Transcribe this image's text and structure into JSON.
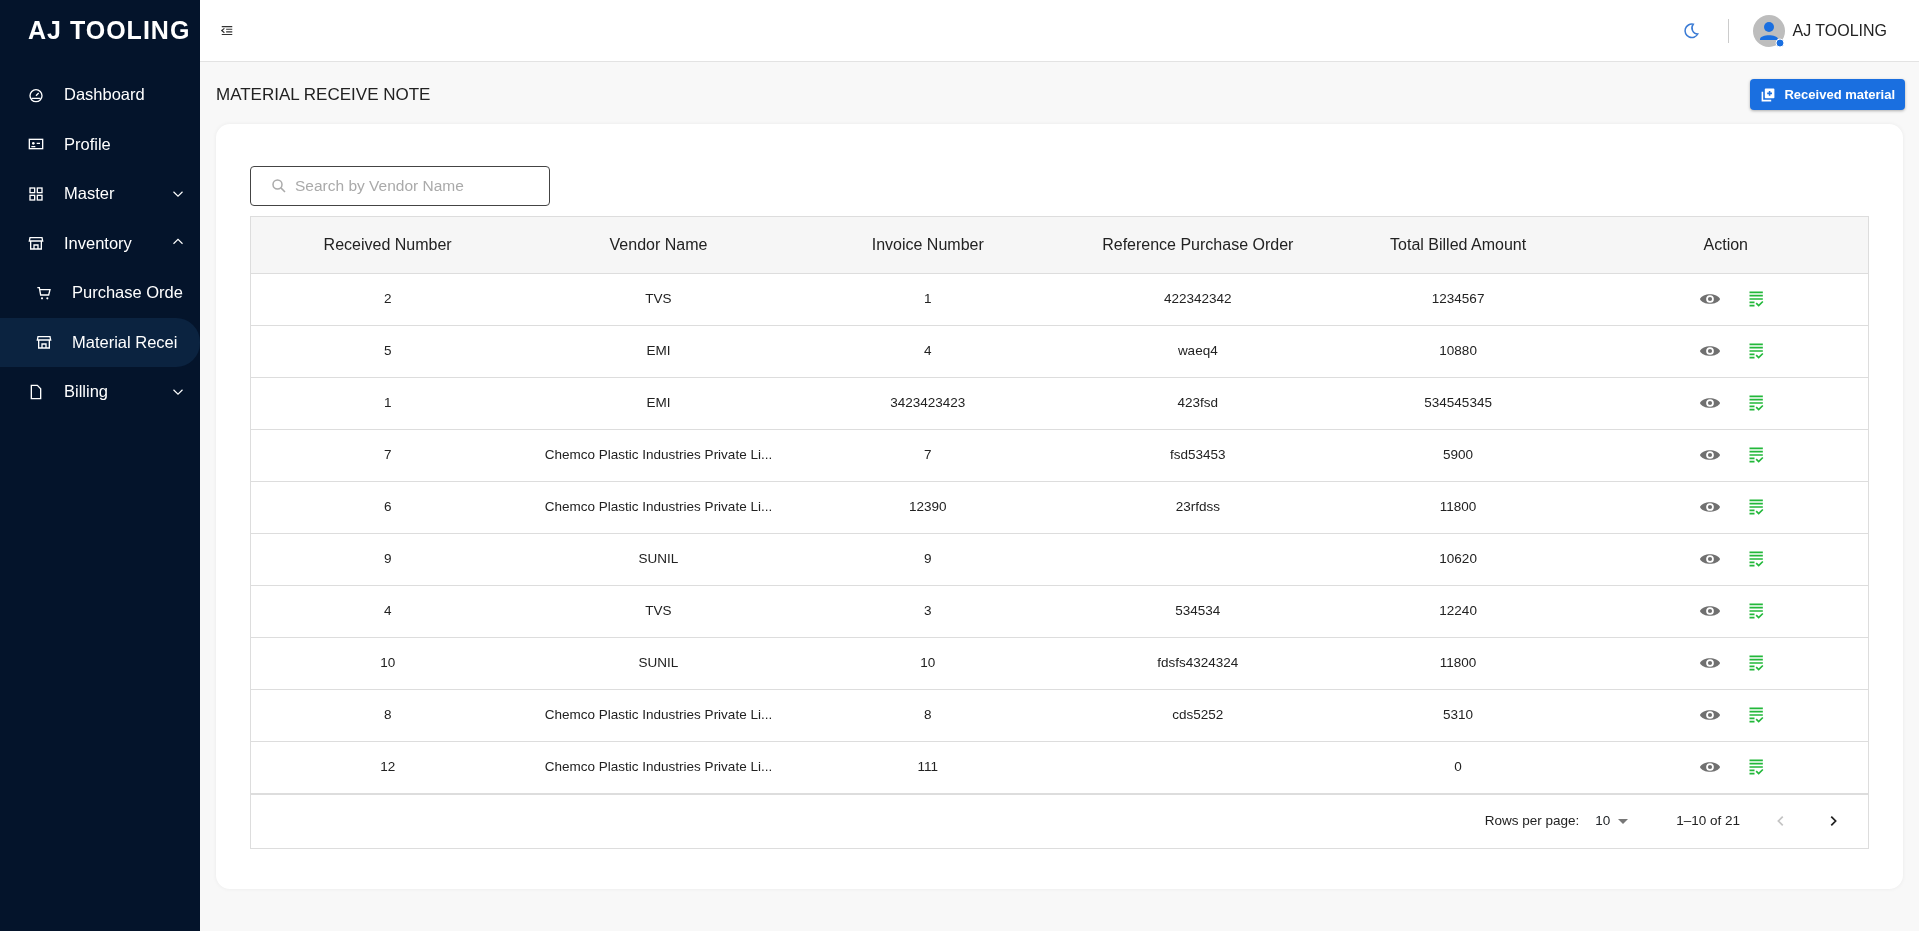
{
  "brand": "AJ TOOLING",
  "sidebar": {
    "items": [
      {
        "kind": "link",
        "label": "Dashboard",
        "selected": false
      },
      {
        "kind": "link",
        "label": "Profile",
        "selected": false
      },
      {
        "kind": "group",
        "label": "Master",
        "expanded": false
      },
      {
        "kind": "group",
        "label": "Inventory",
        "expanded": true,
        "children": [
          {
            "kind": "link",
            "label": "Purchase Orde",
            "selected": false
          },
          {
            "kind": "link",
            "label": "Material Recei",
            "selected": true
          }
        ]
      },
      {
        "kind": "group",
        "label": "Billing",
        "expanded": false
      }
    ]
  },
  "topbar": {
    "user": "AJ TOOLING"
  },
  "page_title": "MATERIAL RECEIVE NOTE",
  "add_button": "Received material",
  "search": {
    "placeholder": "Search by Vendor Name"
  },
  "table": {
    "columns": [
      "Received Number",
      "Vendor Name",
      "Invoice Number",
      "Reference Purchase Order",
      "Total Billed Amount",
      "Action"
    ],
    "rows": [
      [
        "2",
        "TVS",
        "1",
        "422342342",
        "1234567"
      ],
      [
        "5",
        "EMI",
        "4",
        "waeq4",
        "10880"
      ],
      [
        "1",
        "EMI",
        "3423423423",
        "423fsd",
        "534545345"
      ],
      [
        "7",
        "Chemco Plastic Industries Private Li...",
        "7",
        "fsd53453",
        "5900"
      ],
      [
        "6",
        "Chemco Plastic Industries Private Li...",
        "12390",
        "23rfdss",
        "11800"
      ],
      [
        "9",
        "SUNIL",
        "9",
        null,
        "10620"
      ],
      [
        "4",
        "TVS",
        "3",
        "534534",
        "12240"
      ],
      [
        "10",
        "SUNIL",
        "10",
        "fdsfs4324324",
        "11800"
      ],
      [
        "8",
        "Chemco Plastic Industries Private Li...",
        "8",
        "cds5252",
        "5310"
      ],
      [
        "12",
        "Chemco Plastic Industries Private Li...",
        "111",
        null,
        "0"
      ]
    ]
  },
  "pagination": {
    "rows_per_page_label": "Rows per page:",
    "rows_per_page": "10",
    "range": "1–10 of 21",
    "prev_disabled": true,
    "next_disabled": false
  }
}
